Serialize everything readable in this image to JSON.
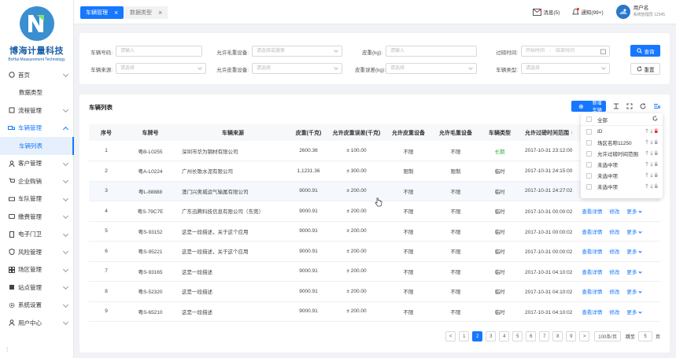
{
  "brand": {
    "name": "博海计量科技",
    "sub": "BoHai Measurement Technology"
  },
  "tabs": [
    {
      "label": "车辆管理"
    },
    {
      "label": "数据类型"
    }
  ],
  "header": {
    "messages": "消息(5)",
    "notices": "通知(99+)",
    "user_name": "用户名",
    "user_desc": "系统管理员 12345"
  },
  "sidebar": {
    "items": [
      {
        "label": "首页"
      },
      {
        "label": "数据类型"
      },
      {
        "label": "流程管理"
      },
      {
        "label": "车辆管理"
      },
      {
        "label": "车辆列表"
      },
      {
        "label": "客户管理"
      },
      {
        "label": "企业购销"
      },
      {
        "label": "车队管理"
      },
      {
        "label": "缴费管理"
      },
      {
        "label": "电子门卫"
      },
      {
        "label": "风险管理"
      },
      {
        "label": "场区管理"
      },
      {
        "label": "站点管理"
      },
      {
        "label": "系统设置"
      },
      {
        "label": "用户中心"
      }
    ]
  },
  "filters": {
    "plate_label": "车辆号码:",
    "plate_ph": "请输入",
    "allow_gross_label": "允许毛重设备:",
    "allow_gross_ph": "请选择或搜索",
    "tare_label": "皮重(kg):",
    "tare_ph": "请输入",
    "time_label": "过磅时间:",
    "time_start": "开始时间",
    "time_sep": "-",
    "time_end": "结束时间",
    "source_label": "车辆来源:",
    "source_ph": "请选择",
    "allow_tare_label": "允许皮重设备:",
    "allow_tare_ph": "请选择",
    "tare_err_label": "皮重误差(kg):",
    "tare_err_ph": "请选择",
    "type_label": "车辆类型:",
    "type_ph": "请选择",
    "query": "查询",
    "reset": "重置"
  },
  "list": {
    "title": "车辆列表",
    "add_button": "新增车辆",
    "columns": [
      "序号",
      "车牌号",
      "车辆来源",
      "皮重(千克)",
      "允许皮重误差(千克)",
      "允许皮重设备",
      "允许毛重设备",
      "车辆类型",
      "允许过磅时间范围"
    ],
    "rows": [
      {
        "no": "1",
        "plate": "粤B-L0255",
        "source": "深圳市华为钢材有限公司",
        "tare": "2600.36",
        "err": "± 100.00",
        "tdev": "不限",
        "gdev": "不限",
        "type": "长期",
        "time": "2017-10-31 23:12:00",
        "view": "",
        "edit": "",
        "more": ""
      },
      {
        "no": "2",
        "plate": "粤A-L0224",
        "source": "广州长歌水泥有限公司",
        "tare": "1,1231.36",
        "err": "± 300.00",
        "tdev": "限制",
        "gdev": "限制",
        "type": "临时",
        "time": "2017-10-31 24:15:00",
        "view": "",
        "edit": "",
        "more": ""
      },
      {
        "no": "3",
        "plate": "粤L-88888",
        "source": "澳门兴奥城运气输属有限公司",
        "tare": "9000.91",
        "err": "± 200.00",
        "tdev": "不限",
        "gdev": "不限",
        "type": "临时",
        "time": "2017-10-31 24:27:02",
        "view": "",
        "edit": "",
        "more": ""
      },
      {
        "no": "4",
        "plate": "粤S-79C7E",
        "source": "广东迅腾科技信息有限公司（东莞）",
        "tare": "9000.91",
        "err": "± 200.00",
        "tdev": "不限",
        "gdev": "不限",
        "type": "临时",
        "time": "2017-10-31 00:00:02",
        "view": "查看详情",
        "edit": "修改",
        "more": "更多"
      },
      {
        "no": "5",
        "plate": "粤S-93152",
        "source": "这是一段描述，关于这个应用",
        "tare": "9000.91",
        "err": "± 200.00",
        "tdev": "不限",
        "gdev": "不限",
        "type": "临时",
        "time": "2017-10-31 00:00:02",
        "view": "查看详情",
        "edit": "修改",
        "more": "更多"
      },
      {
        "no": "6",
        "plate": "粤S-95221",
        "source": "这是一段描述，关于这个应用",
        "tare": "9000.91",
        "err": "± 200.00",
        "tdev": "不限",
        "gdev": "不限",
        "type": "临时",
        "time": "2017-10-31 00:00:02",
        "view": "查看详情",
        "edit": "修改",
        "more": "更多"
      },
      {
        "no": "7",
        "plate": "粤S-93165",
        "source": "这是一段描述",
        "tare": "9000.91",
        "err": "± 200.00",
        "tdev": "不限",
        "gdev": "不限",
        "type": "临时",
        "time": "2017-10-31 04:10:02",
        "view": "查看详情",
        "edit": "修改",
        "more": "更多"
      },
      {
        "no": "8",
        "plate": "粤S-52320",
        "source": "这是一段描述",
        "tare": "9000.91",
        "err": "± 200.00",
        "tdev": "不限",
        "gdev": "不限",
        "type": "临时",
        "time": "2017-10-31 04:10:02",
        "view": "查看详情",
        "edit": "修改",
        "more": "更多"
      },
      {
        "no": "9",
        "plate": "粤S-65210",
        "source": "这是一段描述",
        "tare": "9000.91",
        "err": "± 200.00",
        "tdev": "不限",
        "gdev": "不限",
        "type": "临时",
        "time": "2017-10-31 04:10:02",
        "view": "查看详情",
        "edit": "修改",
        "more": "更多"
      }
    ]
  },
  "column_panel": {
    "all": "全部",
    "items": [
      {
        "label": "ID"
      },
      {
        "label": "场区名称11250"
      },
      {
        "label": "允许过磅时间范围"
      },
      {
        "label": "未选中项"
      },
      {
        "label": "未选中项"
      },
      {
        "label": "未选中项"
      }
    ]
  },
  "pagination": {
    "prev": "<",
    "next": ">",
    "pages": [
      "1",
      "2",
      "3",
      "4",
      "5",
      "6",
      "7",
      "8",
      "9"
    ],
    "page_size": "100条/页",
    "goto_label": "跳至",
    "goto_value": "5",
    "goto_unit": "页"
  },
  "colors": {
    "primary": "#1677ff",
    "green": "#3cb043",
    "logo": "#1a5fa8"
  }
}
